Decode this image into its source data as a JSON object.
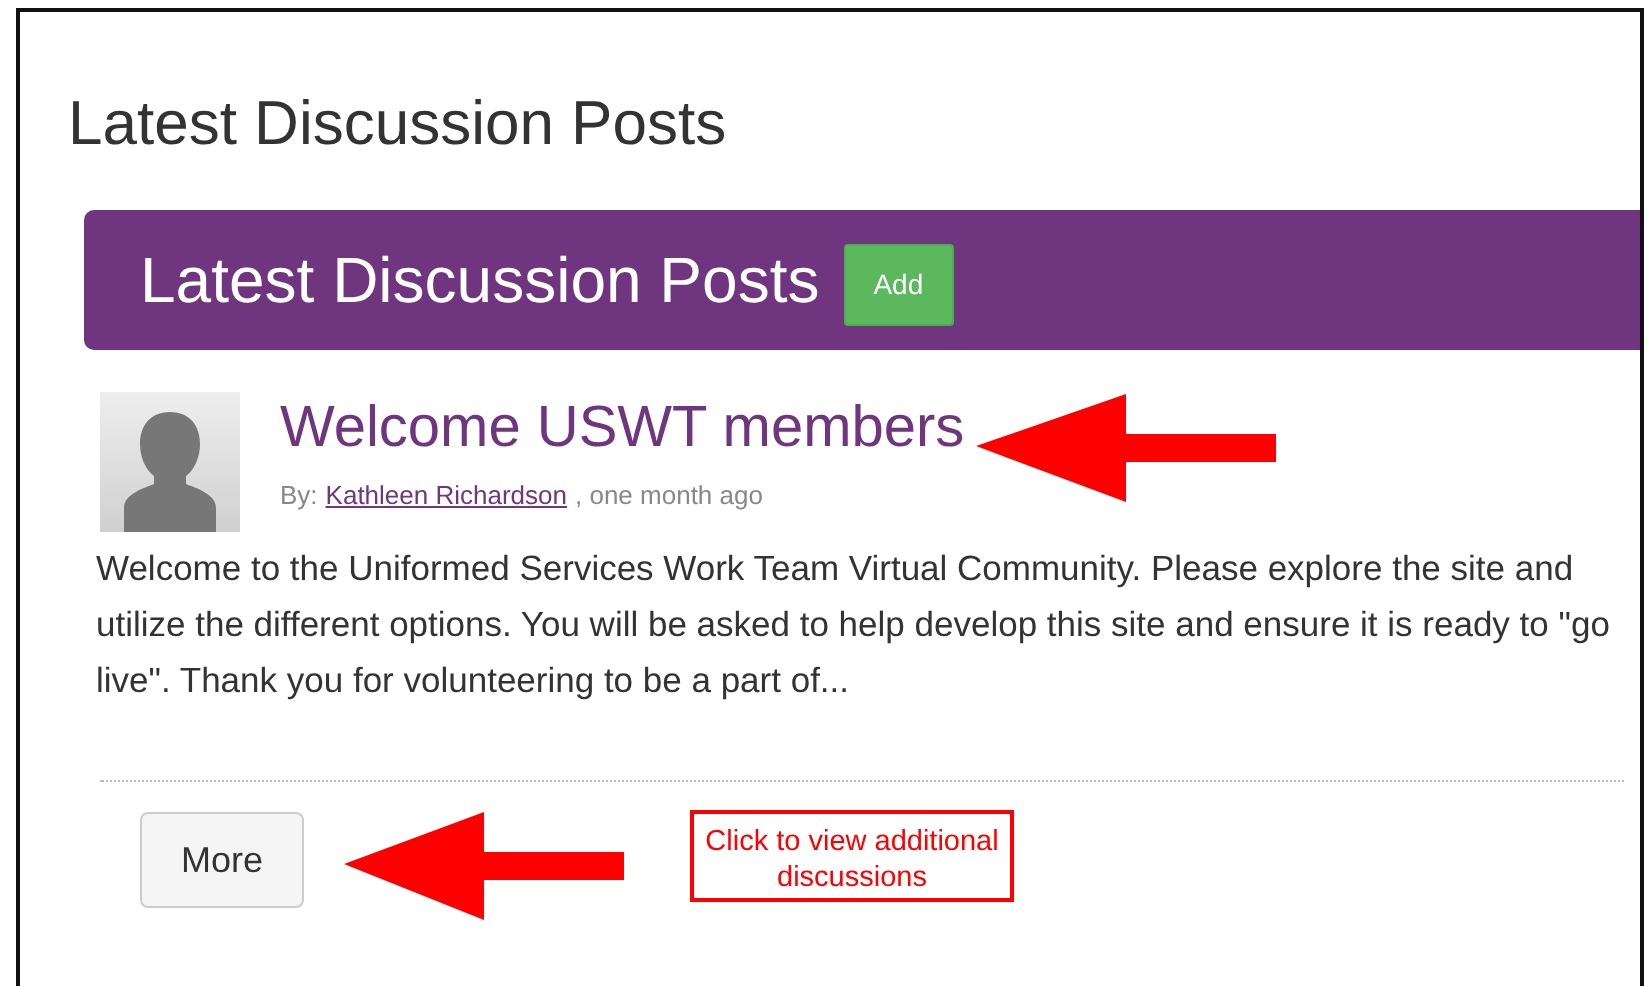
{
  "page_title": "Latest Discussion Posts",
  "panel": {
    "title": "Latest Discussion Posts",
    "add_button": "Add"
  },
  "posts": [
    {
      "title": "Welcome USWT members",
      "by_label": "By:",
      "author": "Kathleen Richardson",
      "time": ", one month ago",
      "excerpt": "Welcome to the Uniformed Services Work Team Virtual Community. Please explore the site and utilize the different options. You will be asked to help develop this site and ensure it is ready to \"go live\". Thank you for volunteering to be a part of..."
    }
  ],
  "more_button": "More",
  "callout": "Click to view additional discussions"
}
